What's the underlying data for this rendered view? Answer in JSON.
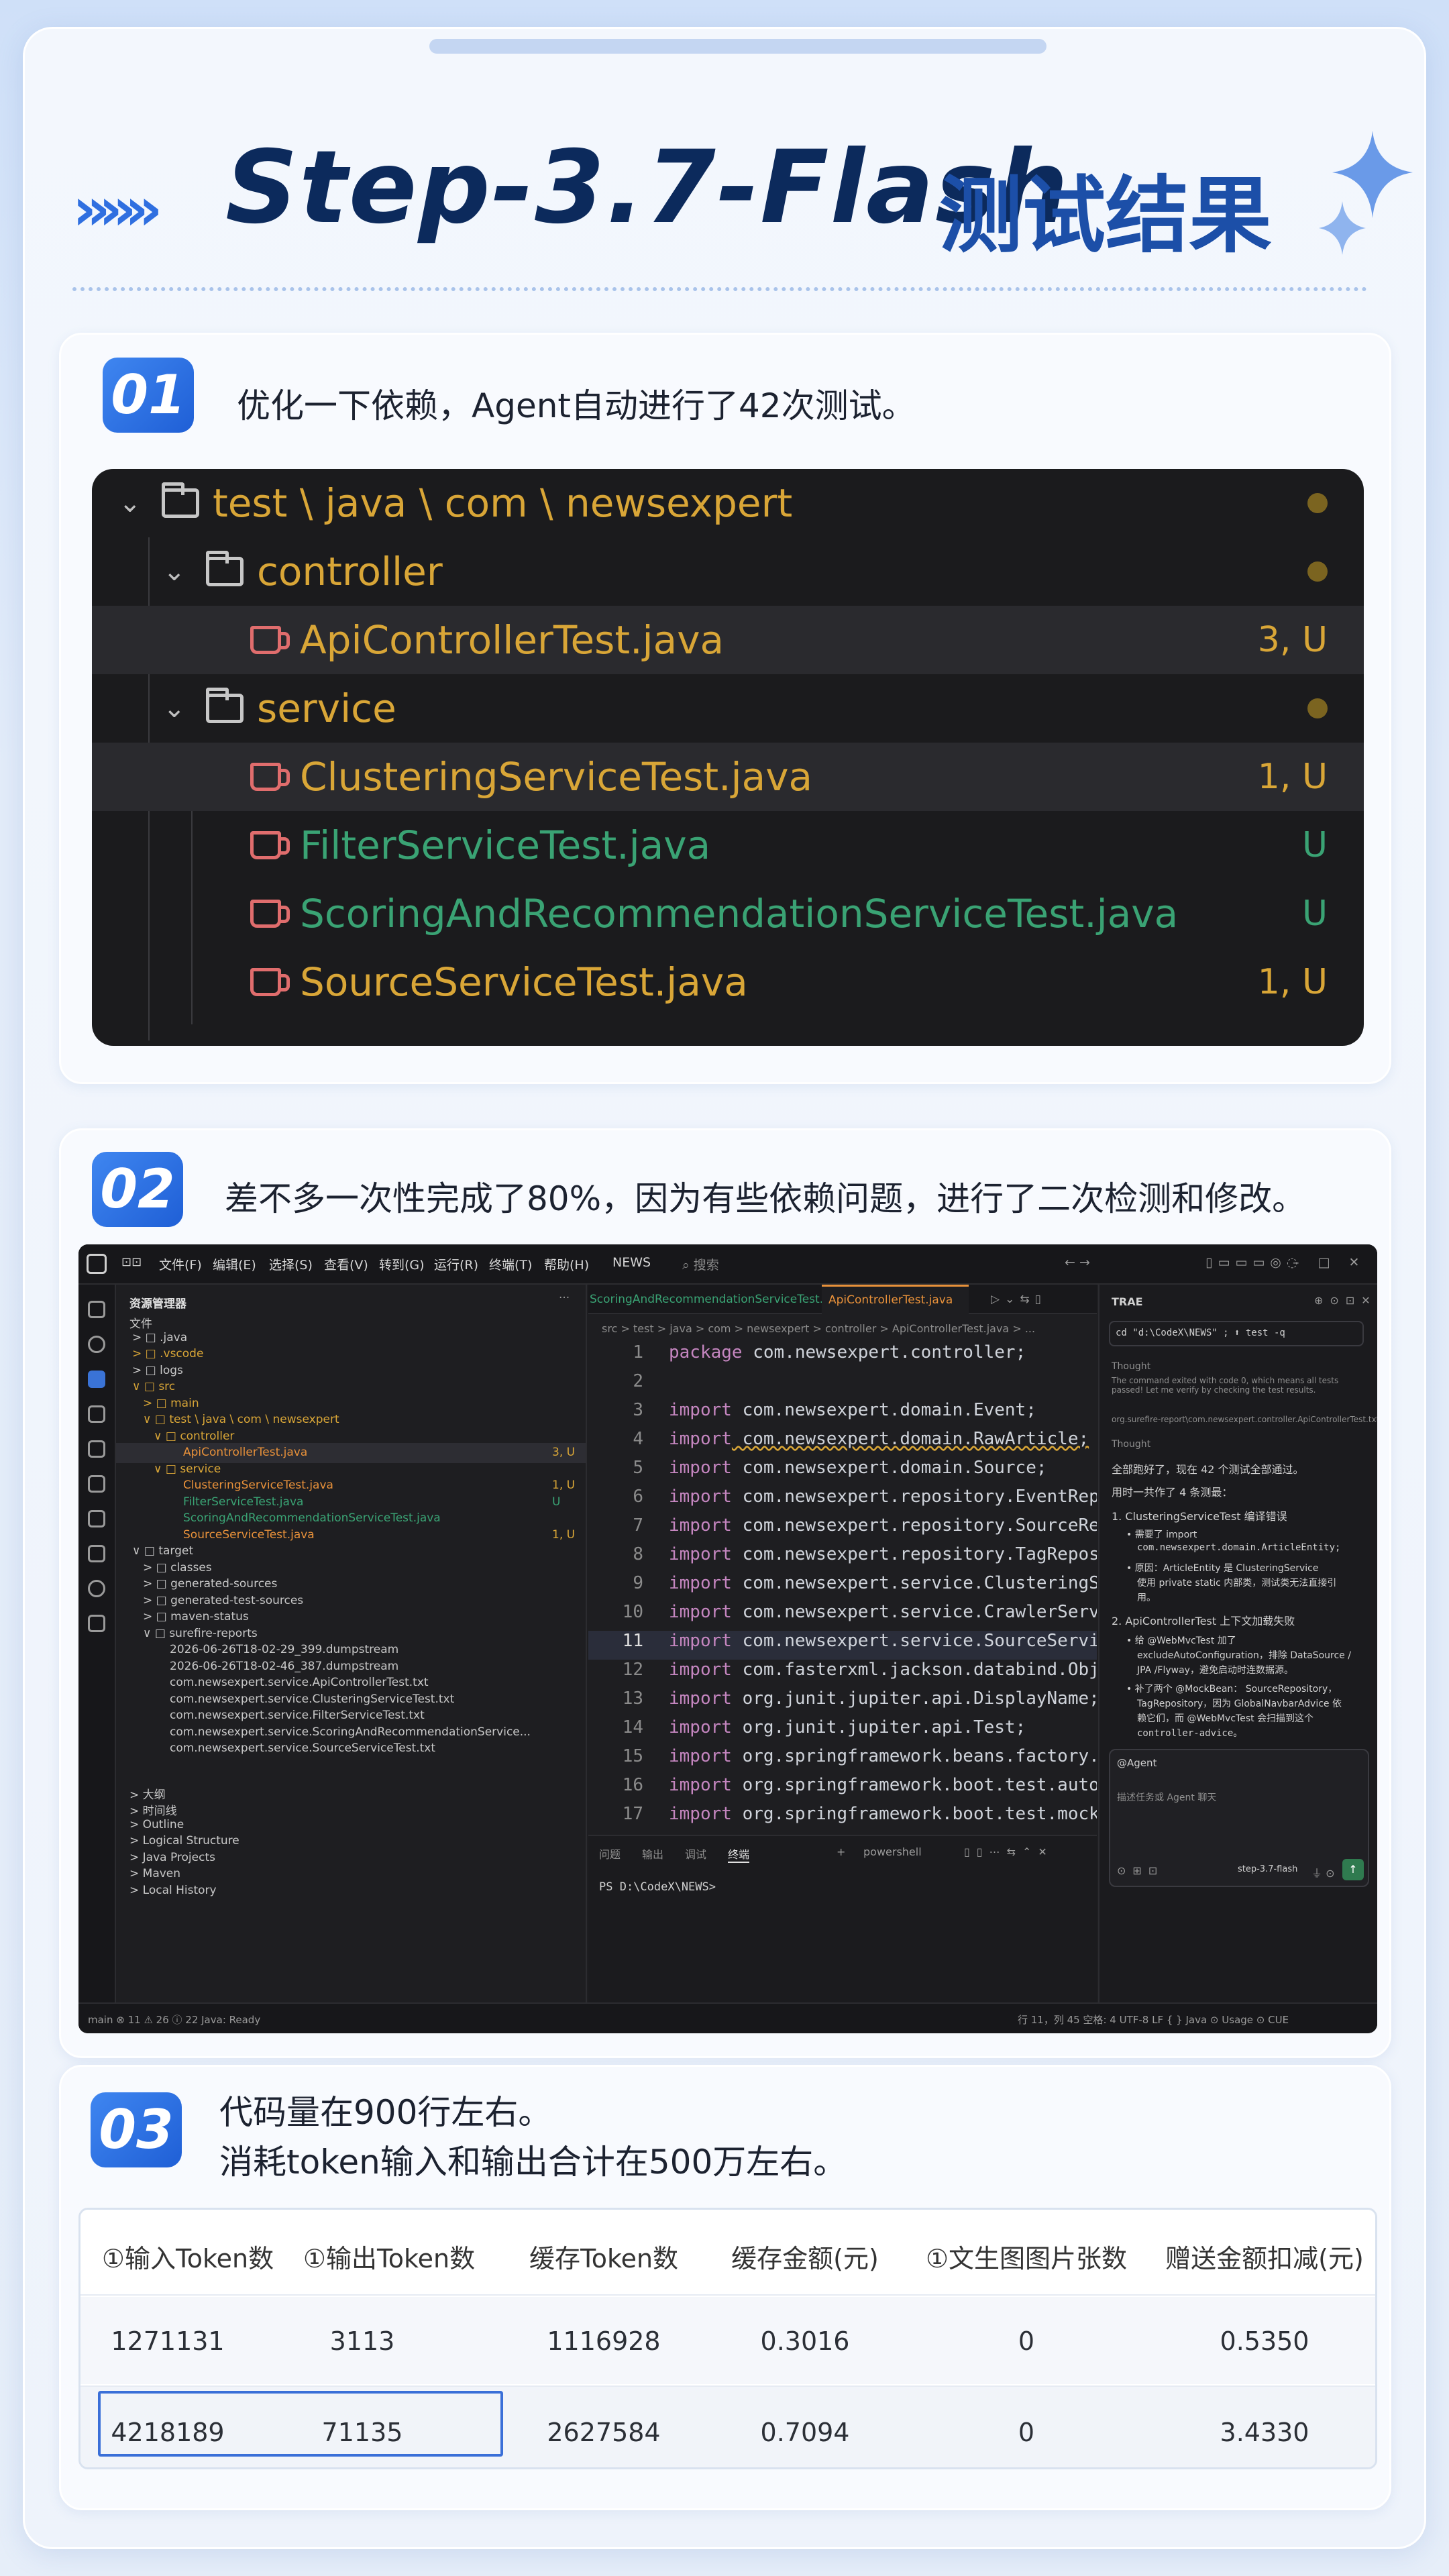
{
  "header": {
    "chevrons": "»»»",
    "title_en": "Step-3.7-Flash",
    "title_cn": "测试结果"
  },
  "section1": {
    "num": "01",
    "text": "优化一下依赖，Agent自动进行了42次测试。",
    "tree": [
      {
        "type": "folder",
        "name": "test \\ java \\ com \\ newsexpert",
        "color": "#d9a637",
        "indicator": "dot"
      },
      {
        "type": "folder",
        "name": "controller",
        "color": "#d9a637",
        "indicator": "dot"
      },
      {
        "type": "file",
        "name": "ApiControllerTest.java",
        "color": "#d9a637",
        "status": "3, U",
        "status_color": "#d9a637"
      },
      {
        "type": "folder",
        "name": "service",
        "color": "#d9a637",
        "indicator": "dot"
      },
      {
        "type": "file",
        "name": "ClusteringServiceTest.java",
        "color": "#d9a637",
        "status": "1, U",
        "status_color": "#d9a637"
      },
      {
        "type": "file",
        "name": "FilterServiceTest.java",
        "color": "#3aa374",
        "status": "U",
        "status_color": "#3aa374"
      },
      {
        "type": "file",
        "name": "ScoringAndRecommendationServiceTest.java",
        "color": "#3aa374",
        "status": "U",
        "status_color": "#3aa374"
      },
      {
        "type": "file",
        "name": "SourceServiceTest.java",
        "color": "#d9a637",
        "status": "1, U",
        "status_color": "#d9a637"
      }
    ]
  },
  "section2": {
    "num": "02",
    "text": "差不多一次性完成了80%，因为有些依赖问题，进行了二次检测和修改。",
    "ide": {
      "menu": [
        "文件(F)",
        "编辑(E)",
        "选择(S)",
        "查看(V)",
        "转到(G)",
        "运行(R)",
        "终端(T)",
        "帮助(H)"
      ],
      "project": "NEWS",
      "search": "搜索",
      "explorer_title": "资源管理器",
      "explorer_rows": [
        "文件",
        "> □ .java",
        "> □ .vscode",
        "> □ logs",
        "∨ □ src",
        "> □ main",
        "∨ □ test \\ java \\ com \\ newsexpert",
        "∨ □ controller",
        "ApiControllerTest.java",
        "∨ □ service",
        "ClusteringServiceTest.java",
        "FilterServiceTest.java",
        "ScoringAndRecommendationServiceTest.java",
        "SourceServiceTest.java",
        "∨ □ target",
        "> □ classes",
        "> □ generated-sources",
        "> □ generated-test-sources",
        "> □ maven-status",
        "∨ □ surefire-reports",
        "2026-06-26T18-02-29_399.dumpstream",
        "2026-06-26T18-02-46_387.dumpstream",
        "com.newsexpert.service.ApiControllerTest.txt",
        "com.newsexpert.service.ClusteringServiceTest.txt",
        "com.newsexpert.service.FilterServiceTest.txt",
        "com.newsexpert.service.ScoringAndRecommendationService...",
        "com.newsexpert.service.SourceServiceTest.txt",
        "> 大纲",
        "> 时间线",
        "> Outline",
        "> Logical Structure",
        "> Java Projects",
        "> Maven",
        "> Local History"
      ],
      "explorer_badges": [
        "3, U",
        "1, U",
        "U",
        "1, U"
      ],
      "tabs": [
        "ScoringAndRecommendationServiceTest.java",
        "ApiControllerTest.java"
      ],
      "breadcrumb": "src > test > java > com > newsexpert > controller > ApiControllerTest.java > ...",
      "code_lines": [
        {
          "n": "1",
          "kw": "package",
          "rest": " com.newsexpert.controller;"
        },
        {
          "n": "2",
          "kw": "",
          "rest": ""
        },
        {
          "n": "3",
          "kw": "import",
          "rest": " com.newsexpert.domain.Event;"
        },
        {
          "n": "4",
          "kw": "import",
          "rest": " com.newsexpert.domain.RawArticle;"
        },
        {
          "n": "5",
          "kw": "import",
          "rest": " com.newsexpert.domain.Source;"
        },
        {
          "n": "6",
          "kw": "import",
          "rest": " com.newsexpert.repository.EventRepos"
        },
        {
          "n": "7",
          "kw": "import",
          "rest": " com.newsexpert.repository.SourceRepo"
        },
        {
          "n": "8",
          "kw": "import",
          "rest": " com.newsexpert.repository.TagReposit"
        },
        {
          "n": "9",
          "kw": "import",
          "rest": " com.newsexpert.service.ClusteringSer"
        },
        {
          "n": "10",
          "kw": "import",
          "rest": " com.newsexpert.service.CrawlerServic"
        },
        {
          "n": "11",
          "kw": "import",
          "rest": " com.newsexpert.service.SourceService"
        },
        {
          "n": "12",
          "kw": "import",
          "rest": " com.fasterxml.jackson.databind.Objec"
        },
        {
          "n": "13",
          "kw": "import",
          "rest": " org.junit.jupiter.api.DisplayName;"
        },
        {
          "n": "14",
          "kw": "import",
          "rest": " org.junit.jupiter.api.Test;"
        },
        {
          "n": "15",
          "kw": "import",
          "rest": " org.springframework.beans.factory.ann"
        },
        {
          "n": "16",
          "kw": "import",
          "rest": " org.springframework.boot.test.autoco"
        },
        {
          "n": "17",
          "kw": "import",
          "rest": " org.springframework.boot.test.mock.m"
        }
      ],
      "terminal_tabs": [
        "问题",
        "输出",
        "调试",
        "终端"
      ],
      "terminal_shell": "powershell",
      "terminal_prompt": "PS D:\\CodeX\\NEWS>",
      "chat": {
        "title": "TRAE",
        "command": "cd \"d:\\CodeX\\NEWS\" ; ⬆ test -q",
        "thought1": "Thought",
        "thought1_text": "The command exited with code 0, which means all tests passed! Let me verify by checking the test results.",
        "file_ref": "org.surefire-report\\com.newsexpert.controller.ApiControllerTest.txt",
        "thought2": "Thought",
        "summary": "全部跑好了，现在 42 个测试全部通过。",
        "fixed": "用时一共作了 4 条测最：",
        "item1": "1. ClusteringServiceTest 编译错误",
        "item1_a": "• 需要了 import",
        "item1_b": "com.newsexpert.domain.ArticleEntity;",
        "item1_c": "• 原因：ArticleEntity 是 ClusteringService",
        "item1_d": "使用 private static 内部类，测试类无法直接引",
        "item1_e": "用。",
        "item2": "2. ApiControllerTest 上下文加载失败",
        "item2_a": "• 给 @WebMvcTest 加了",
        "item2_b": "excludeAutoConfiguration，排除 DataSource /",
        "item2_c": "JPA /Flyway，避免启动时连数据源。",
        "item2_d": "• 补了两个 @MockBean： SourceRepository，",
        "item2_e": "TagRepository，因为 GlobalNavbarAdvice 依",
        "item2_f": "赖它们，而 @WebMvcTest 会扫描到这个",
        "item2_g": "controller-advice。",
        "agent_label": "@Agent",
        "input_placeholder": "描述任务或 Agent 聊天",
        "model": "step-3.7-flash"
      },
      "statusbar_left": "main  ⊗ 11 ⚠ 26 ⓘ 22   Java: Ready",
      "statusbar_right": "行 11，列 45  空格: 4  UTF-8  LF  { } Java  ⊙ Usage  ⊙ CUE"
    }
  },
  "section3": {
    "num": "03",
    "text1": "代码量在900行左右。",
    "text2": "消耗token输入和输出合计在500万左右。",
    "table": {
      "headers": [
        "①输入Token数",
        "①输出Token数",
        "缓存Token数",
        "缓存金额(元)",
        "①文生图图片张数",
        "赠送金额扣减(元)"
      ],
      "rows": [
        [
          "1271131",
          "3113",
          "1116928",
          "0.3016",
          "0",
          "0.5350"
        ],
        [
          "4218189",
          "71135",
          "2627584",
          "0.7094",
          "0",
          "3.4330"
        ]
      ]
    }
  },
  "colors": {
    "accent": "#2f6fe0",
    "title": "#0c2a5c",
    "folder_yellow": "#d9a637",
    "untracked_green": "#3aa374",
    "test_icon_red": "#e06d6d"
  }
}
